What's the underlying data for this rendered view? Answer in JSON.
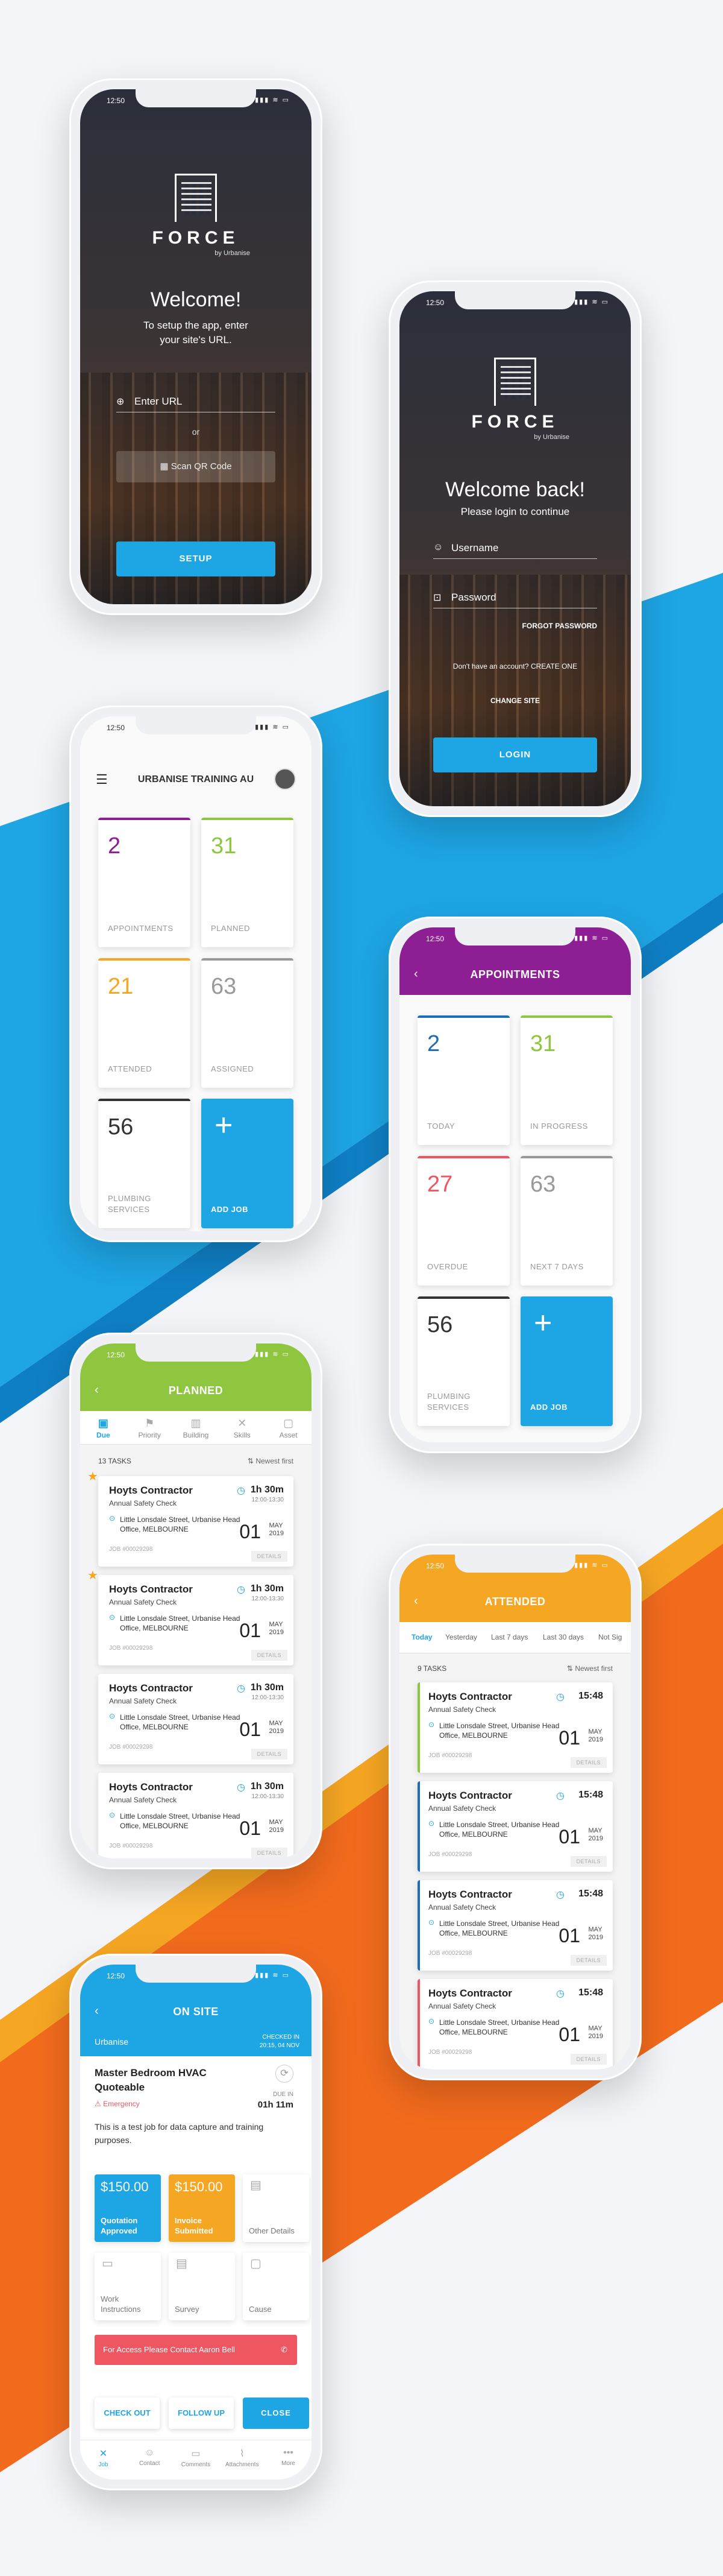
{
  "colors": {
    "blue": "#1ea5e4",
    "orange": "#f26b1d",
    "green": "#8ec63f",
    "purple": "#8e1e94",
    "amber": "#f5a623",
    "red": "#ee5662"
  },
  "status_time": "12:50",
  "status_icons": "▮▮▮ ≋ ▭",
  "brand": {
    "word": "FORCE",
    "by": "by Urbanise"
  },
  "setup": {
    "title": "Welcome!",
    "subtitle": "To setup the app, enter your site's URL.",
    "url_placeholder": "Enter URL",
    "or": "or",
    "qr": "Scan QR Code",
    "button": "SETUP"
  },
  "login": {
    "title": "Welcome back!",
    "subtitle": "Please login to continue",
    "username": "Username",
    "password": "Password",
    "forgot": "FORGOT PASSWORD",
    "noacct": "Don't have an account? CREATE ONE",
    "change": "CHANGE SITE",
    "button": "LOGIN"
  },
  "dashboard": {
    "title": "URBANISE TRAINING AU",
    "tiles": [
      {
        "n": "2",
        "label": "APPOINTMENTS",
        "color": "#8e1e94"
      },
      {
        "n": "31",
        "label": "PLANNED",
        "color": "#8ec63f"
      },
      {
        "n": "21",
        "label": "ATTENDED",
        "color": "#f5a623"
      },
      {
        "n": "63",
        "label": "ASSIGNED",
        "color": "#999999"
      },
      {
        "n": "56",
        "label": "PLUMBING SERVICES",
        "color": "#333333"
      }
    ],
    "add": "ADD JOB"
  },
  "appointments": {
    "title": "APPOINTMENTS",
    "tiles": [
      {
        "n": "2",
        "label": "TODAY",
        "color": "#1e6bb8"
      },
      {
        "n": "31",
        "label": "IN PROGRESS",
        "color": "#8ec63f"
      },
      {
        "n": "27",
        "label": "OVERDUE",
        "color": "#ee5662"
      },
      {
        "n": "63",
        "label": "NEXT 7 DAYS",
        "color": "#999999"
      },
      {
        "n": "56",
        "label": "PLUMBING SERVICES",
        "color": "#333333"
      }
    ],
    "add": "ADD JOB"
  },
  "planned": {
    "title": "PLANNED",
    "tabs": [
      "Due",
      "Priority",
      "Building",
      "Skills",
      "Asset"
    ],
    "count": "13 TASKS",
    "sort": "Newest first"
  },
  "attended": {
    "title": "ATTENDED",
    "tabs": [
      "Today",
      "Yesterday",
      "Last 7 days",
      "Last 30 days",
      "Not Sig"
    ],
    "count": "9 TASKS",
    "sort": "Newest first"
  },
  "job": {
    "name": "Hoyts Contractor",
    "type": "Annual Safety Check",
    "addr": "Little Lonsdale Street, Urbanise Head Office, MELBOURNE",
    "jobno": "JOB #00029298",
    "time": "1h 30m",
    "range": "12:00-13:30",
    "time2": "15:48",
    "day": "01",
    "month": "MAY",
    "year": "2019",
    "details": "DETAILS"
  },
  "onsite": {
    "title": "ON SITE",
    "site": "Urbanise",
    "checked": "CHECKED IN",
    "checked_when": "20:15, 04 NOV",
    "job": "Master Bedroom HVAC Quoteable",
    "priority": "Emergency",
    "due_label": "DUE IN",
    "due": "01h 11m",
    "desc": "This is a test job for data capture and training purposes.",
    "q_val": "$150.00",
    "q_label": "Quotation Approved",
    "i_val": "$150.00",
    "i_label": "Invoice Submitted",
    "other": "Other Details",
    "work": "Work Instructions",
    "survey": "Survey",
    "cause": "Cause",
    "access": "For Access Please Contact Aaron Bell",
    "checkout": "CHECK OUT",
    "followup": "FOLLOW UP",
    "close": "CLOSE",
    "nav": [
      "Job",
      "Contact",
      "Comments",
      "Attachments",
      "More"
    ]
  }
}
